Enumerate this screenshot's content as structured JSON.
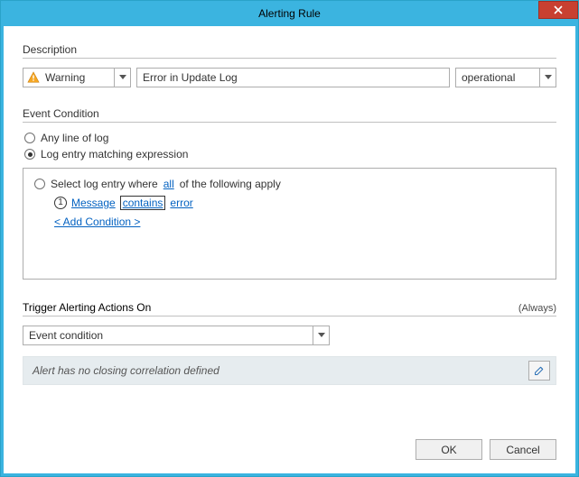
{
  "window": {
    "title": "Alerting Rule"
  },
  "sections": {
    "description": "Description",
    "event_condition": "Event Condition",
    "trigger": "Trigger Alerting Actions On"
  },
  "description_row": {
    "severity": {
      "value": "Warning"
    },
    "name": {
      "value": "Error in Update Log"
    },
    "log_type": {
      "value": "operational"
    }
  },
  "event_condition": {
    "radio_any": "Any line of log",
    "radio_expr": "Log entry matching expression",
    "selected": "expr",
    "expr": {
      "prefix": "Select log entry where",
      "quantifier": "all",
      "suffix": "of the following apply",
      "conditions": [
        {
          "num": "1",
          "field": "Message",
          "op": "contains",
          "value": "error"
        }
      ],
      "add": "< Add Condition >"
    }
  },
  "trigger": {
    "always_label": "(Always)",
    "mode": {
      "value": "Event condition"
    },
    "correlation_msg": "Alert has no closing correlation defined"
  },
  "buttons": {
    "ok": "OK",
    "cancel": "Cancel"
  }
}
